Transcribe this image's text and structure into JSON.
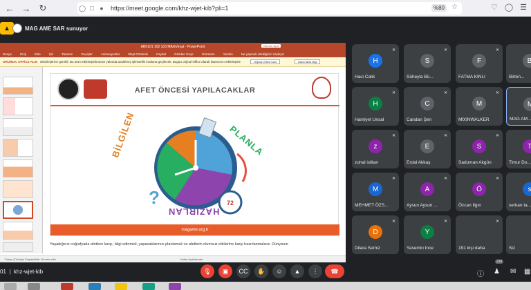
{
  "browser": {
    "url": "https://meet.google.com/khz-wjet-kib?pli=1",
    "zoom": "%80"
  },
  "meet": {
    "presenter_text": "MAG AME SAR sunuyor",
    "meeting_code": "khz-wjet-kib",
    "participant_count": "210"
  },
  "powerpoint": {
    "window_title": "AB0101 102 103 MAGVeyat - PowerPoint",
    "signin_label": "Oturum açın",
    "ribbon": [
      "Dosya",
      "Giriş",
      "Ekle",
      "Çiz",
      "Tasarım",
      "Geçişler",
      "Animasyonlar",
      "Slayt Gösterisi",
      "Kaydet",
      "Gözden Geçir",
      "Görünüm",
      "Yardım",
      "Ne yapmak istediğinizi söyleyin"
    ],
    "banner_tag": "ORİJİNAL OFFİCE ALIN",
    "banner_text": "Etkinleştirme gerekli. Bu ürün etkinleştirilmezse yakında azaltılmış işlevsellik moduna geçilecek. Bugün orijinal Office alarak lisansınızı etkinleştirin.",
    "banner_btn1": "Orijinal Office'i alın",
    "banner_btn2": "Daha fazla bilgi",
    "slide_title": "AFET ÖNCESİ YAPILACAKLAR",
    "clock_words": [
      "BİLGİLEN",
      "PLANLA",
      "HAZIRLAN"
    ],
    "slide_footer": "magame.org.tr",
    "notes_text": "Yaşadığınız coğrafyada afetlere karşı, bilgi edinmeli, yapacaklarınızı planlamalı ve afetlerin olumsuz etkilerine karşı hazırlanmalısız. Dünyanın",
    "status_text": "Notlar   Açıklamalar",
    "status_left": "Türkçe (Türkiye)   Erişilebilirlik: Devam edin"
  },
  "participants": [
    {
      "name": "Haci Calik",
      "initial": "H",
      "color": "#1a73e8"
    },
    {
      "name": "Süheyla Bü...",
      "initial": "S",
      "color": "#5f6368"
    },
    {
      "name": "FATMA KINLI",
      "initial": "F",
      "color": "#5f6368"
    },
    {
      "name": "Birten...",
      "initial": "B",
      "color": "#5f6368"
    },
    {
      "name": "Hamiyet Unsal",
      "initial": "H",
      "color": "#0b8043"
    },
    {
      "name": "Candan Şen",
      "initial": "C",
      "color": "#5f6368"
    },
    {
      "name": "M00NWALKER",
      "initial": "M",
      "color": "#5f6368"
    },
    {
      "name": "MAG AM...",
      "initial": "M",
      "color": "#5f6368"
    },
    {
      "name": "zuhal isiltan",
      "initial": "z",
      "color": "#8e24aa"
    },
    {
      "name": "Erdal Akkaş",
      "initial": "E",
      "color": "#5f6368"
    },
    {
      "name": "Saduman Akgün",
      "initial": "S",
      "color": "#8e24aa"
    },
    {
      "name": "Timur Do...",
      "initial": "T",
      "color": "#8e24aa"
    },
    {
      "name": "MEHMET ÖZS...",
      "initial": "M",
      "color": "#1967d2"
    },
    {
      "name": "Aysun Aysun ...",
      "initial": "A",
      "color": "#8e24aa"
    },
    {
      "name": "Özcan Ilgın",
      "initial": "Ö",
      "color": "#8e24aa"
    },
    {
      "name": "serkan ta...",
      "initial": "s",
      "color": "#1967d2"
    },
    {
      "name": "Dilara Semiz",
      "initial": "D",
      "color": "#e8710a"
    },
    {
      "name": "Yasemin Ince",
      "initial": "Y",
      "color": "#0b8043"
    },
    {
      "name": "191 kişi daha",
      "initial": "",
      "color": "#3c4043"
    },
    {
      "name": "Siz",
      "initial": "",
      "color": "#3c4043"
    }
  ],
  "icons": {
    "back": "back-arrow-icon",
    "forward": "forward-arrow-icon",
    "reload": "reload-icon",
    "mic_off": "mic-off-icon",
    "camera_off": "camera-off-icon",
    "captions": "captions-icon",
    "raise_hand": "raise-hand-icon",
    "emoji": "emoji-icon",
    "present": "present-icon",
    "more": "more-options-icon",
    "end_call": "end-call-icon"
  }
}
